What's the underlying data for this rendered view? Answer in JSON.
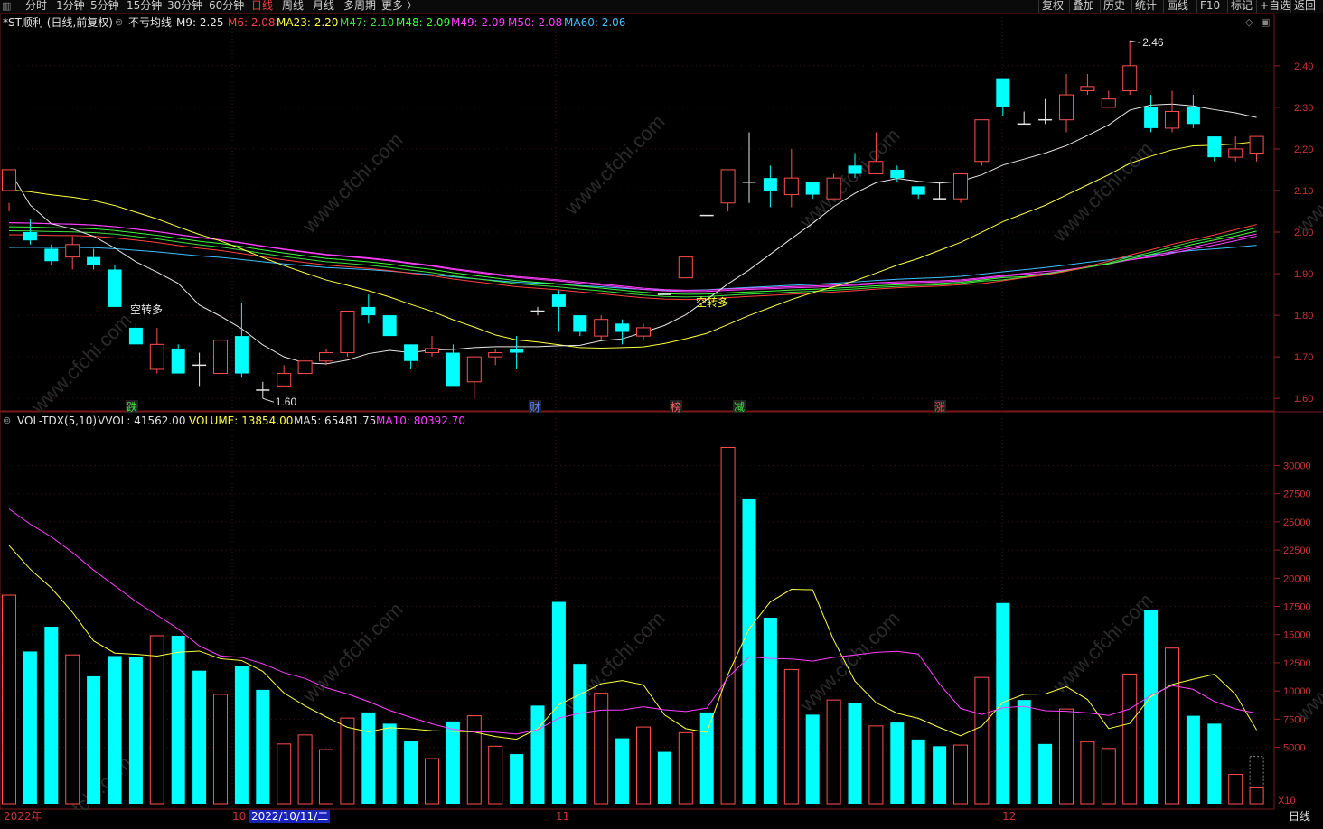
{
  "toolbar": {
    "periods": [
      "分时",
      "1分钟",
      "5分钟",
      "15分钟",
      "30分钟",
      "60分钟",
      "日线",
      "周线",
      "月线",
      "多周期",
      "更多 〉"
    ],
    "active_period": "日线",
    "right_buttons": [
      "复权",
      "叠加",
      "历史",
      "统计",
      "画线",
      "F10",
      "标记",
      "+自选",
      "返回"
    ]
  },
  "price_header": {
    "stock": "*ST顺利 (日线,前复权)",
    "indicator": "不亏均线",
    "ma_items": [
      {
        "label": "M9: 2.25",
        "color": "#e8e8e8"
      },
      {
        "label": "M6: 2.08",
        "color": "#ff4040"
      },
      {
        "label": "MA23: 2.20",
        "color": "#ffff40"
      },
      {
        "label": "M47: 2.10",
        "color": "#40e040"
      },
      {
        "label": "M48: 2.09",
        "color": "#40ff40"
      },
      {
        "label": "M49: 2.09",
        "color": "#ff40ff"
      },
      {
        "label": "M50: 2.08",
        "color": "#ff40ff"
      },
      {
        "label": "MA60: 2.06",
        "color": "#40c0ff"
      }
    ]
  },
  "vol_header": {
    "indicator": "VOL-TDX(5,10)",
    "items": [
      {
        "label": "VVOL: 41562.00",
        "color": "#e0e0e0"
      },
      {
        "label": "VOLUME: 13854.00",
        "color": "#ffff40"
      },
      {
        "label": "MA5: 65481.75",
        "color": "#e0e0e0"
      },
      {
        "label": "MA10: 80392.70",
        "color": "#ff40ff"
      }
    ]
  },
  "price_axis": [
    "2.40",
    "2.30",
    "2.20",
    "2.10",
    "2.00",
    "1.90",
    "1.80",
    "1.70",
    "1.60"
  ],
  "vol_axis": [
    "30000",
    "27500",
    "25000",
    "22500",
    "20000",
    "17500",
    "15000",
    "12500",
    "10000",
    "7500",
    "5000"
  ],
  "vol_unit": "X10",
  "annotations": {
    "high_label": "2.46",
    "low_label": "1.60",
    "signal1": "空转多",
    "signal2": "空转多"
  },
  "event_markers": [
    {
      "text": "跌",
      "color": "#40e040"
    },
    {
      "text": "财",
      "color": "#6080ff"
    },
    {
      "text": "榜",
      "color": "#ff6060"
    },
    {
      "text": "减",
      "color": "#40e040"
    },
    {
      "text": "涨",
      "color": "#ff4040"
    }
  ],
  "bottom_bar": {
    "year_label": "2022年",
    "month_10": "10",
    "cursor_date": "2022/10/11/二",
    "month_11": "11",
    "month_12": "12",
    "period_label": "日线"
  },
  "watermark": "www.cfchi.com",
  "chart_data": {
    "type": "candlestick",
    "ylim_price": [
      1.57,
      2.48
    ],
    "ylim_volume": [
      0,
      33000
    ],
    "candles": [
      [
        2.1,
        2.15,
        2.07,
        2.05
      ],
      [
        2.0,
        1.98,
        2.03,
        1.97
      ],
      [
        1.96,
        1.93,
        1.97,
        1.92
      ],
      [
        1.94,
        1.97,
        1.99,
        1.91
      ],
      [
        1.94,
        1.92,
        1.96,
        1.91
      ],
      [
        1.91,
        1.82,
        1.92,
        1.82
      ],
      [
        1.77,
        1.73,
        1.78,
        1.73
      ],
      [
        1.67,
        1.73,
        1.77,
        1.66
      ],
      [
        1.72,
        1.66,
        1.73,
        1.66
      ],
      [
        1.68,
        1.68,
        1.71,
        1.63
      ],
      [
        1.66,
        1.74,
        1.74,
        1.66
      ],
      [
        1.75,
        1.66,
        1.83,
        1.65
      ],
      [
        1.62,
        1.62,
        1.64,
        1.6
      ],
      [
        1.63,
        1.66,
        1.68,
        1.63
      ],
      [
        1.66,
        1.69,
        1.7,
        1.65
      ],
      [
        1.69,
        1.71,
        1.72,
        1.68
      ],
      [
        1.71,
        1.81,
        1.81,
        1.7
      ],
      [
        1.82,
        1.8,
        1.85,
        1.78
      ],
      [
        1.8,
        1.75,
        1.8,
        1.75
      ],
      [
        1.73,
        1.69,
        1.73,
        1.67
      ],
      [
        1.71,
        1.72,
        1.75,
        1.7
      ],
      [
        1.71,
        1.63,
        1.73,
        1.63
      ],
      [
        1.64,
        1.7,
        1.7,
        1.6
      ],
      [
        1.7,
        1.71,
        1.72,
        1.68
      ],
      [
        1.72,
        1.71,
        1.75,
        1.67
      ],
      [
        1.81,
        1.81,
        1.82,
        1.8
      ],
      [
        1.85,
        1.82,
        1.86,
        1.76
      ],
      [
        1.8,
        1.76,
        1.8,
        1.75
      ],
      [
        1.75,
        1.79,
        1.8,
        1.74
      ],
      [
        1.78,
        1.76,
        1.79,
        1.73
      ],
      [
        1.75,
        1.77,
        1.78,
        1.74
      ],
      [
        1.85,
        1.85,
        1.85,
        1.85
      ],
      [
        1.89,
        1.94,
        1.94,
        1.89
      ],
      [
        2.04,
        2.04,
        2.04,
        2.04
      ],
      [
        2.07,
        2.15,
        2.15,
        2.05
      ],
      [
        2.12,
        2.12,
        2.24,
        2.07
      ],
      [
        2.13,
        2.1,
        2.16,
        2.06
      ],
      [
        2.09,
        2.13,
        2.2,
        2.06
      ],
      [
        2.12,
        2.09,
        2.12,
        2.08
      ],
      [
        2.08,
        2.13,
        2.14,
        2.08
      ],
      [
        2.16,
        2.14,
        2.19,
        2.13
      ],
      [
        2.14,
        2.17,
        2.24,
        2.14
      ],
      [
        2.15,
        2.13,
        2.16,
        2.12
      ],
      [
        2.11,
        2.09,
        2.11,
        2.08
      ],
      [
        2.08,
        2.08,
        2.12,
        2.08
      ],
      [
        2.08,
        2.14,
        2.14,
        2.07
      ],
      [
        2.17,
        2.27,
        2.27,
        2.16
      ],
      [
        2.37,
        2.3,
        2.37,
        2.28
      ],
      [
        2.26,
        2.26,
        2.29,
        2.26
      ],
      [
        2.27,
        2.27,
        2.32,
        2.26
      ],
      [
        2.27,
        2.33,
        2.38,
        2.24
      ],
      [
        2.34,
        2.35,
        2.38,
        2.33
      ],
      [
        2.3,
        2.32,
        2.34,
        2.3
      ],
      [
        2.34,
        2.4,
        2.46,
        2.33
      ],
      [
        2.3,
        2.25,
        2.33,
        2.24
      ],
      [
        2.25,
        2.29,
        2.34,
        2.24
      ],
      [
        2.3,
        2.26,
        2.33,
        2.25
      ],
      [
        2.23,
        2.18,
        2.23,
        2.17
      ],
      [
        2.18,
        2.2,
        2.23,
        2.17
      ],
      [
        2.19,
        2.23,
        2.23,
        2.17
      ]
    ],
    "volume": [
      18500,
      13500,
      15700,
      13200,
      11300,
      13100,
      13000,
      14900,
      14900,
      11800,
      9700,
      12200,
      10100,
      5300,
      6100,
      4800,
      7600,
      8100,
      7100,
      5600,
      4000,
      7300,
      7800,
      5100,
      4400,
      8700,
      17900,
      12400,
      9800,
      5800,
      6800,
      4600,
      6300,
      8100,
      31600,
      27000,
      16500,
      11900,
      7900,
      9200,
      8900,
      6900,
      7200,
      5700,
      5100,
      5200,
      11200,
      17800,
      9200,
      5300,
      8400,
      5500,
      4900,
      11500,
      17200,
      13800,
      7800,
      7100,
      2600,
      1400
    ]
  }
}
